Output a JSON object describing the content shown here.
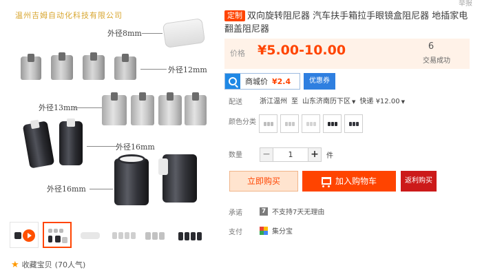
{
  "gallery": {
    "watermark": "温州吉姆自动化科技有限公司",
    "labels": {
      "d8": "外径8mm",
      "d12": "外径12mm",
      "d13": "外径13mm",
      "d16a": "外径16mm",
      "d16b": "外径16mm"
    },
    "thumbnails": [
      "video-thumb",
      "thumb-2",
      "thumb-3",
      "thumb-4",
      "thumb-5",
      "thumb-6"
    ],
    "favorite_label": "收藏宝贝",
    "favorite_count": "(70人气)"
  },
  "product": {
    "tag": "定制",
    "title": "双向旋转阻尼器 汽车扶手箱拉手眼镜盒阻尼器 地插家电翻盖阻尼器",
    "scroll_hint": "举报"
  },
  "price": {
    "label": "价格",
    "value": "¥5.00-10.00",
    "sold_count": "6",
    "sold_label": "交易成功"
  },
  "mall": {
    "label": "商城价",
    "price": "¥2.4",
    "coupon": "优惠券"
  },
  "shipping": {
    "label": "配送",
    "from": "浙江温州",
    "to_word": "至",
    "to": "山东济南历下区",
    "express": "快递 ¥12.00"
  },
  "options": {
    "label": "颜色分类",
    "swatch_colors": [
      [
        "#bdbdbd",
        "#bdbdbd",
        "#bdbdbd"
      ],
      [
        "#c9c9c9",
        "#c9c9c9",
        "#c9c9c9"
      ],
      [
        "#d4d4d4",
        "#d4d4d4",
        "#d4d4d4"
      ],
      [
        "#2a2b30",
        "#2a2b30",
        "#2a2b30"
      ],
      [
        "#34363d",
        "#34363d",
        "#34363d"
      ]
    ]
  },
  "quantity": {
    "label": "数量",
    "minus": "−",
    "value": "1",
    "plus": "+",
    "unit": "件"
  },
  "actions": {
    "buy_now": "立即购买",
    "add_to_cart": "加入购物车",
    "rebate": "返利购买"
  },
  "promise": {
    "label": "承诺",
    "text": "不支持7天无理由"
  },
  "payment": {
    "label": "支付",
    "text": "集分宝"
  },
  "colors": {
    "accent": "#ff4400",
    "price_bg": "#fff2e8",
    "coupon_blue": "#2f7fe0",
    "rebate_red": "#cc1a1a"
  }
}
